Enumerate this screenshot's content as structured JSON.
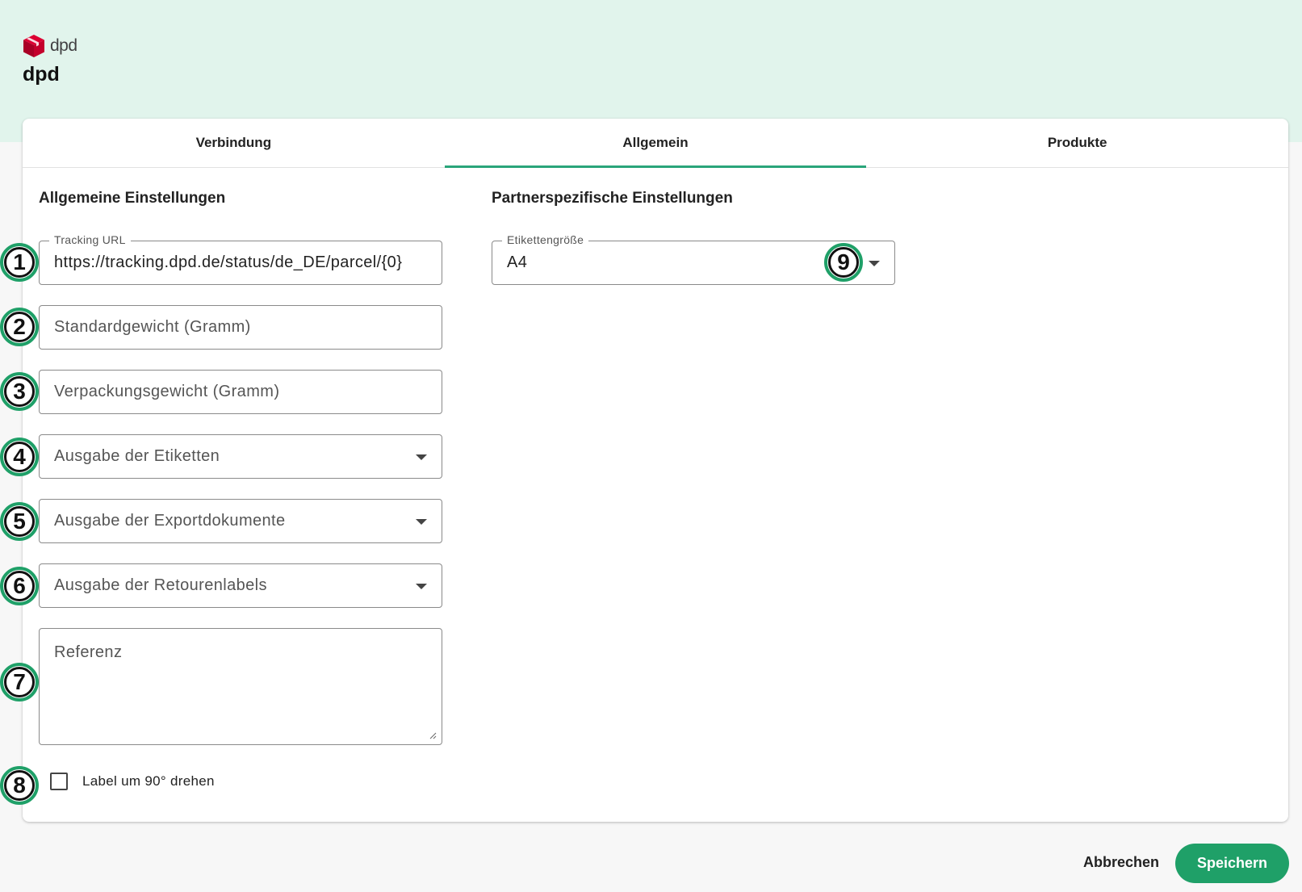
{
  "brand": {
    "logo_word": "dpd",
    "name": "dpd",
    "color": "#dc0032"
  },
  "tabs": [
    {
      "label": "Verbindung",
      "active": false
    },
    {
      "label": "Allgemein",
      "active": true
    },
    {
      "label": "Produkte",
      "active": false
    }
  ],
  "general": {
    "title": "Allgemeine Einstellungen",
    "tracking_url": {
      "label": "Tracking URL",
      "value": "https://tracking.dpd.de/status/de_DE/parcel/{0}"
    },
    "default_weight": {
      "placeholder": "Standardgewicht (Gramm)"
    },
    "packaging_weight": {
      "placeholder": "Verpackungsgewicht (Gramm)"
    },
    "label_output": {
      "placeholder": "Ausgabe der Etiketten"
    },
    "export_docs_output": {
      "placeholder": "Ausgabe der Exportdokumente"
    },
    "return_labels_output": {
      "placeholder": "Ausgabe der Retourenlabels"
    },
    "reference": {
      "placeholder": "Referenz"
    },
    "rotate_label": {
      "label": "Label um 90° drehen",
      "checked": false
    }
  },
  "partner": {
    "title": "Partnerspezifische Einstellungen",
    "label_size": {
      "label": "Etikettengröße",
      "value": "A4"
    }
  },
  "markers": [
    "1",
    "2",
    "3",
    "4",
    "5",
    "6",
    "7",
    "8",
    "9"
  ],
  "footer": {
    "cancel_label": "Abbrechen",
    "save_label": "Speichern"
  },
  "colors": {
    "accent": "#1fa068",
    "header_bg": "#e1f4ec"
  }
}
